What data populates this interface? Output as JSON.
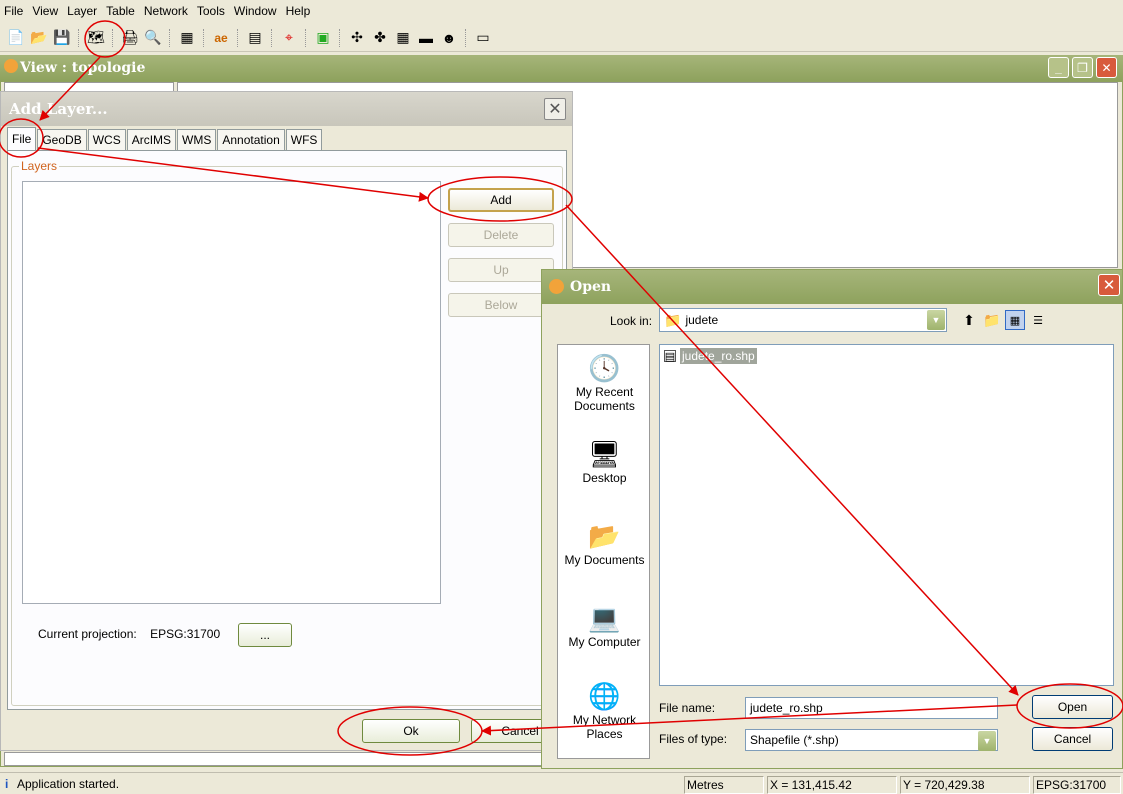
{
  "menu": [
    "File",
    "View",
    "Layer",
    "Table",
    "Network",
    "Tools",
    "Window",
    "Help"
  ],
  "view_window": {
    "title": "View : topologie"
  },
  "add_layer": {
    "title": "Add Layer...",
    "tabs": [
      "File",
      "GeoDB",
      "WCS",
      "ArcIMS",
      "WMS",
      "Annotation",
      "WFS"
    ],
    "group_label": "Layers",
    "buttons": {
      "add": "Add",
      "delete": "Delete",
      "up": "Up",
      "below": "Below",
      "ok": "Ok",
      "cancel": "Cancel"
    },
    "projection_label": "Current projection:",
    "projection_value": "EPSG:31700",
    "projection_button": "..."
  },
  "open_dialog": {
    "title": "Open",
    "look_in_label": "Look in:",
    "look_in_value": "judete",
    "places": [
      "My Recent Documents",
      "Desktop",
      "My Documents",
      "My Computer",
      "My Network Places"
    ],
    "files": [
      "judete_ro.shp"
    ],
    "file_name_label": "File name:",
    "file_name_value": "judete_ro.shp",
    "file_type_label": "Files of type:",
    "file_type_value": "Shapefile (*.shp)",
    "open_button": "Open",
    "cancel_button": "Cancel"
  },
  "status": {
    "message": "Application started.",
    "units": "Metres",
    "x": "X = 131,415.42",
    "y": "Y = 720,429.38",
    "crs": "EPSG:31700"
  },
  "colors": {
    "annotation": "#e00000",
    "titlebar": "#8ea25d"
  }
}
